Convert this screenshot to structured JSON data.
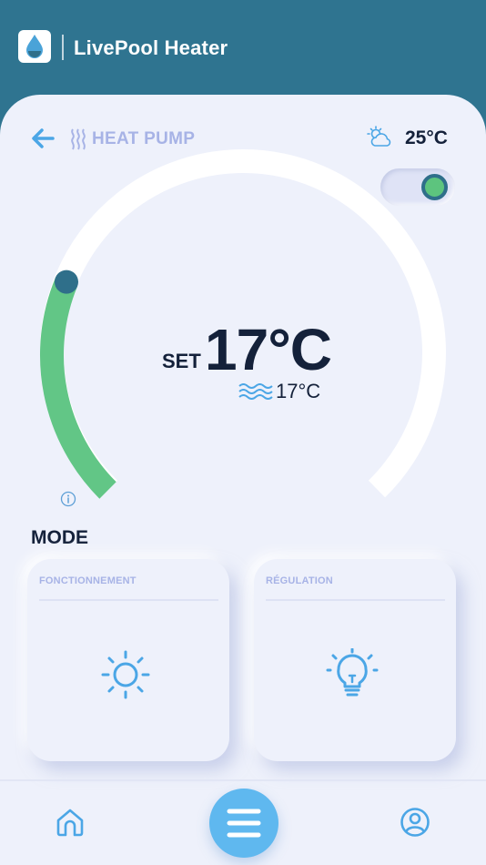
{
  "header": {
    "title": "LivePool Heater",
    "logo_icon": "water-drop-icon"
  },
  "topbar": {
    "back_icon": "arrow-left-icon",
    "device_icon": "heat-waves-icon",
    "device_name": "HEAT PUMP",
    "weather_icon": "partly-cloudy-icon",
    "ambient_temperature": "25°C",
    "power_toggle_on": true
  },
  "thermostat": {
    "set_label": "SET",
    "set_temperature": "17°C",
    "water_icon": "water-waves-icon",
    "water_temperature": "17°C",
    "info_icon": "info-icon",
    "level_fraction": 0.25
  },
  "mode": {
    "title": "MODE",
    "cards": [
      {
        "label": "FONCTIONNEMENT",
        "icon": "sun-icon"
      },
      {
        "label": "RÉGULATION",
        "icon": "lightbulb-icon"
      }
    ]
  },
  "bottom_nav": [
    {
      "name": "home",
      "icon": "home-icon"
    },
    {
      "name": "menu",
      "icon": "menu-icon"
    },
    {
      "name": "profile",
      "icon": "user-circle-icon"
    }
  ],
  "colors": {
    "header": "#2f7490",
    "panel": "#eef1fb",
    "accent_green": "#62c686",
    "accent_blue": "#5fb8ef",
    "label_lavender": "#a7b3e6",
    "text_dark": "#14213a"
  }
}
